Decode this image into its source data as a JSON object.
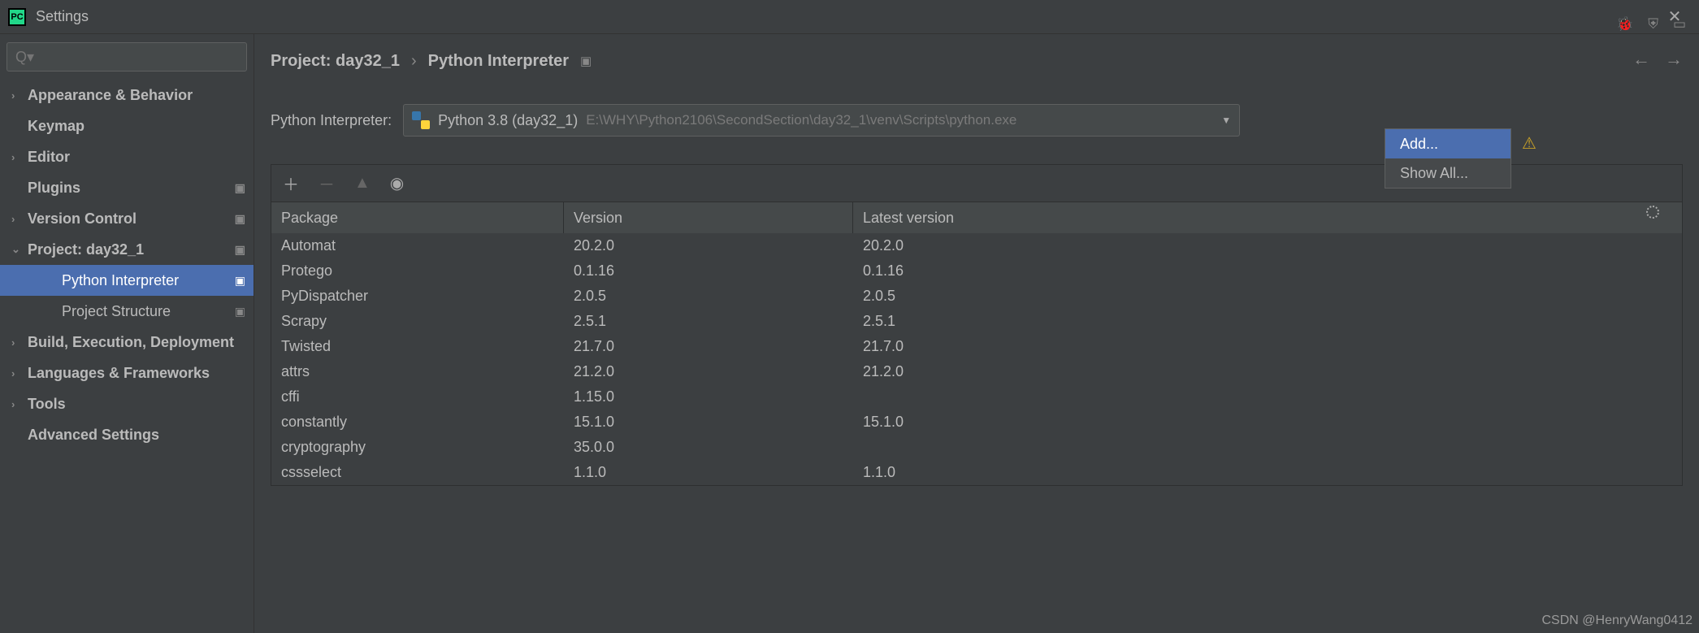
{
  "window": {
    "title": "Settings"
  },
  "search": {
    "placeholder": "Q▾"
  },
  "sidebar": {
    "items": [
      {
        "label": "Appearance & Behavior",
        "chev": "›",
        "bold": true
      },
      {
        "label": "Keymap",
        "bold": true
      },
      {
        "label": "Editor",
        "chev": "›",
        "bold": true
      },
      {
        "label": "Plugins",
        "bold": true,
        "icon": true
      },
      {
        "label": "Version Control",
        "chev": "›",
        "bold": true,
        "icon": true
      },
      {
        "label": "Project: day32_1",
        "chev": "⌄",
        "bold": true,
        "icon": true
      },
      {
        "label": "Python Interpreter",
        "indent": 2,
        "selected": true,
        "icon": true
      },
      {
        "label": "Project Structure",
        "indent": 2,
        "icon": true
      },
      {
        "label": "Build, Execution, Deployment",
        "chev": "›",
        "bold": true
      },
      {
        "label": "Languages & Frameworks",
        "chev": "›",
        "bold": true
      },
      {
        "label": "Tools",
        "chev": "›",
        "bold": true
      },
      {
        "label": "Advanced Settings",
        "bold": true
      }
    ]
  },
  "breadcrumb": {
    "main": "Project: day32_1",
    "sep": "›",
    "sub": "Python Interpreter"
  },
  "interpreter": {
    "label": "Python Interpreter:",
    "name": "Python 3.8 (day32_1)",
    "path": "E:\\WHY\\Python2106\\SecondSection\\day32_1\\venv\\Scripts\\python.exe"
  },
  "dropdown": {
    "add": "Add...",
    "show_all": "Show All..."
  },
  "table": {
    "headers": {
      "package": "Package",
      "version": "Version",
      "latest": "Latest version"
    },
    "rows": [
      {
        "pkg": "Automat",
        "ver": "20.2.0",
        "lat": "20.2.0"
      },
      {
        "pkg": "Protego",
        "ver": "0.1.16",
        "lat": "0.1.16"
      },
      {
        "pkg": "PyDispatcher",
        "ver": "2.0.5",
        "lat": "2.0.5"
      },
      {
        "pkg": "Scrapy",
        "ver": "2.5.1",
        "lat": "2.5.1"
      },
      {
        "pkg": "Twisted",
        "ver": "21.7.0",
        "lat": "21.7.0"
      },
      {
        "pkg": "attrs",
        "ver": "21.2.0",
        "lat": "21.2.0"
      },
      {
        "pkg": "cffi",
        "ver": "1.15.0",
        "lat": ""
      },
      {
        "pkg": "constantly",
        "ver": "15.1.0",
        "lat": "15.1.0"
      },
      {
        "pkg": "cryptography",
        "ver": "35.0.0",
        "lat": ""
      },
      {
        "pkg": "cssselect",
        "ver": "1.1.0",
        "lat": "1.1.0"
      }
    ]
  },
  "watermark": "CSDN @HenryWang0412"
}
